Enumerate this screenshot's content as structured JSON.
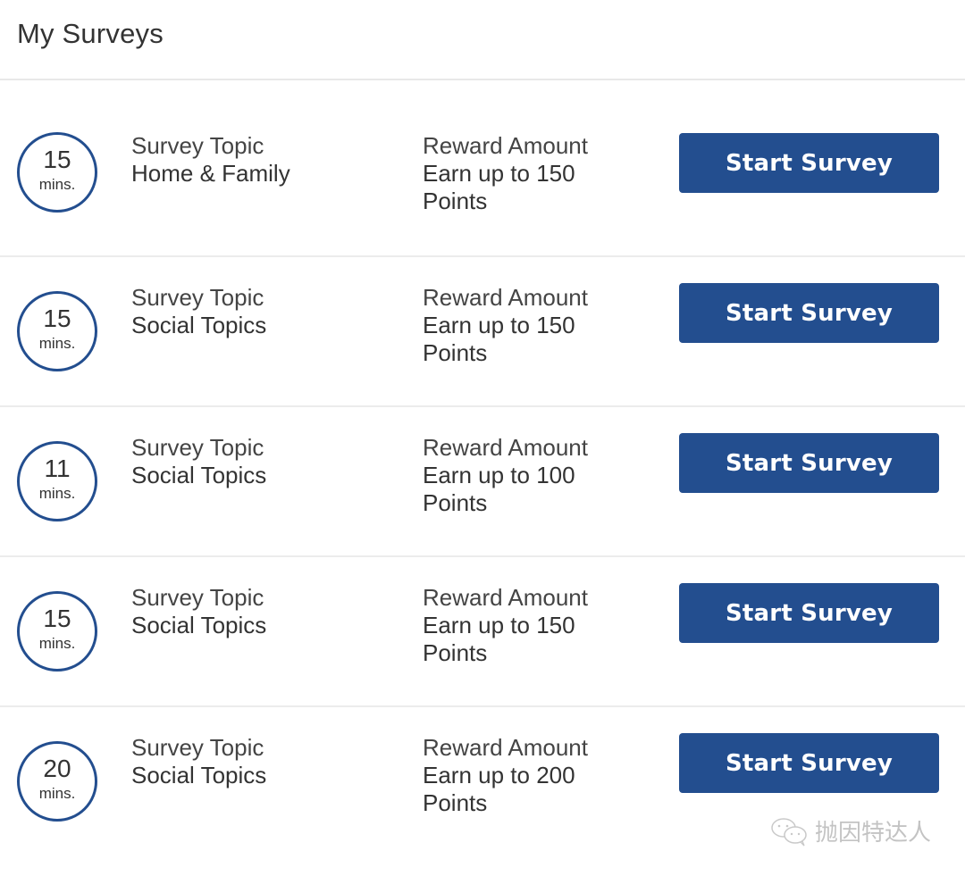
{
  "header": {
    "title": "My Surveys"
  },
  "labels": {
    "topic": "Survey Topic",
    "reward": "Reward Amount",
    "button": "Start Survey"
  },
  "surveys": [
    {
      "minutes": "15",
      "unit": "mins.",
      "topic": "Home & Family",
      "reward_line1": "Earn up to 150",
      "reward_line2": "Points"
    },
    {
      "minutes": "15",
      "unit": "mins.",
      "topic": "Social Topics",
      "reward_line1": "Earn up to 150",
      "reward_line2": "Points"
    },
    {
      "minutes": "11",
      "unit": "mins.",
      "topic": "Social Topics",
      "reward_line1": "Earn up to 100",
      "reward_line2": "Points"
    },
    {
      "minutes": "15",
      "unit": "mins.",
      "topic": "Social Topics",
      "reward_line1": "Earn up to 150",
      "reward_line2": "Points"
    },
    {
      "minutes": "20",
      "unit": "mins.",
      "topic": "Social Topics",
      "reward_line1": "Earn up to 200",
      "reward_line2": "Points"
    }
  ],
  "watermark": {
    "icon": "wechat-icon",
    "text": "抛因特达人"
  },
  "colors": {
    "accent": "#234e8f",
    "divider": "#ececec",
    "text": "#333333"
  }
}
